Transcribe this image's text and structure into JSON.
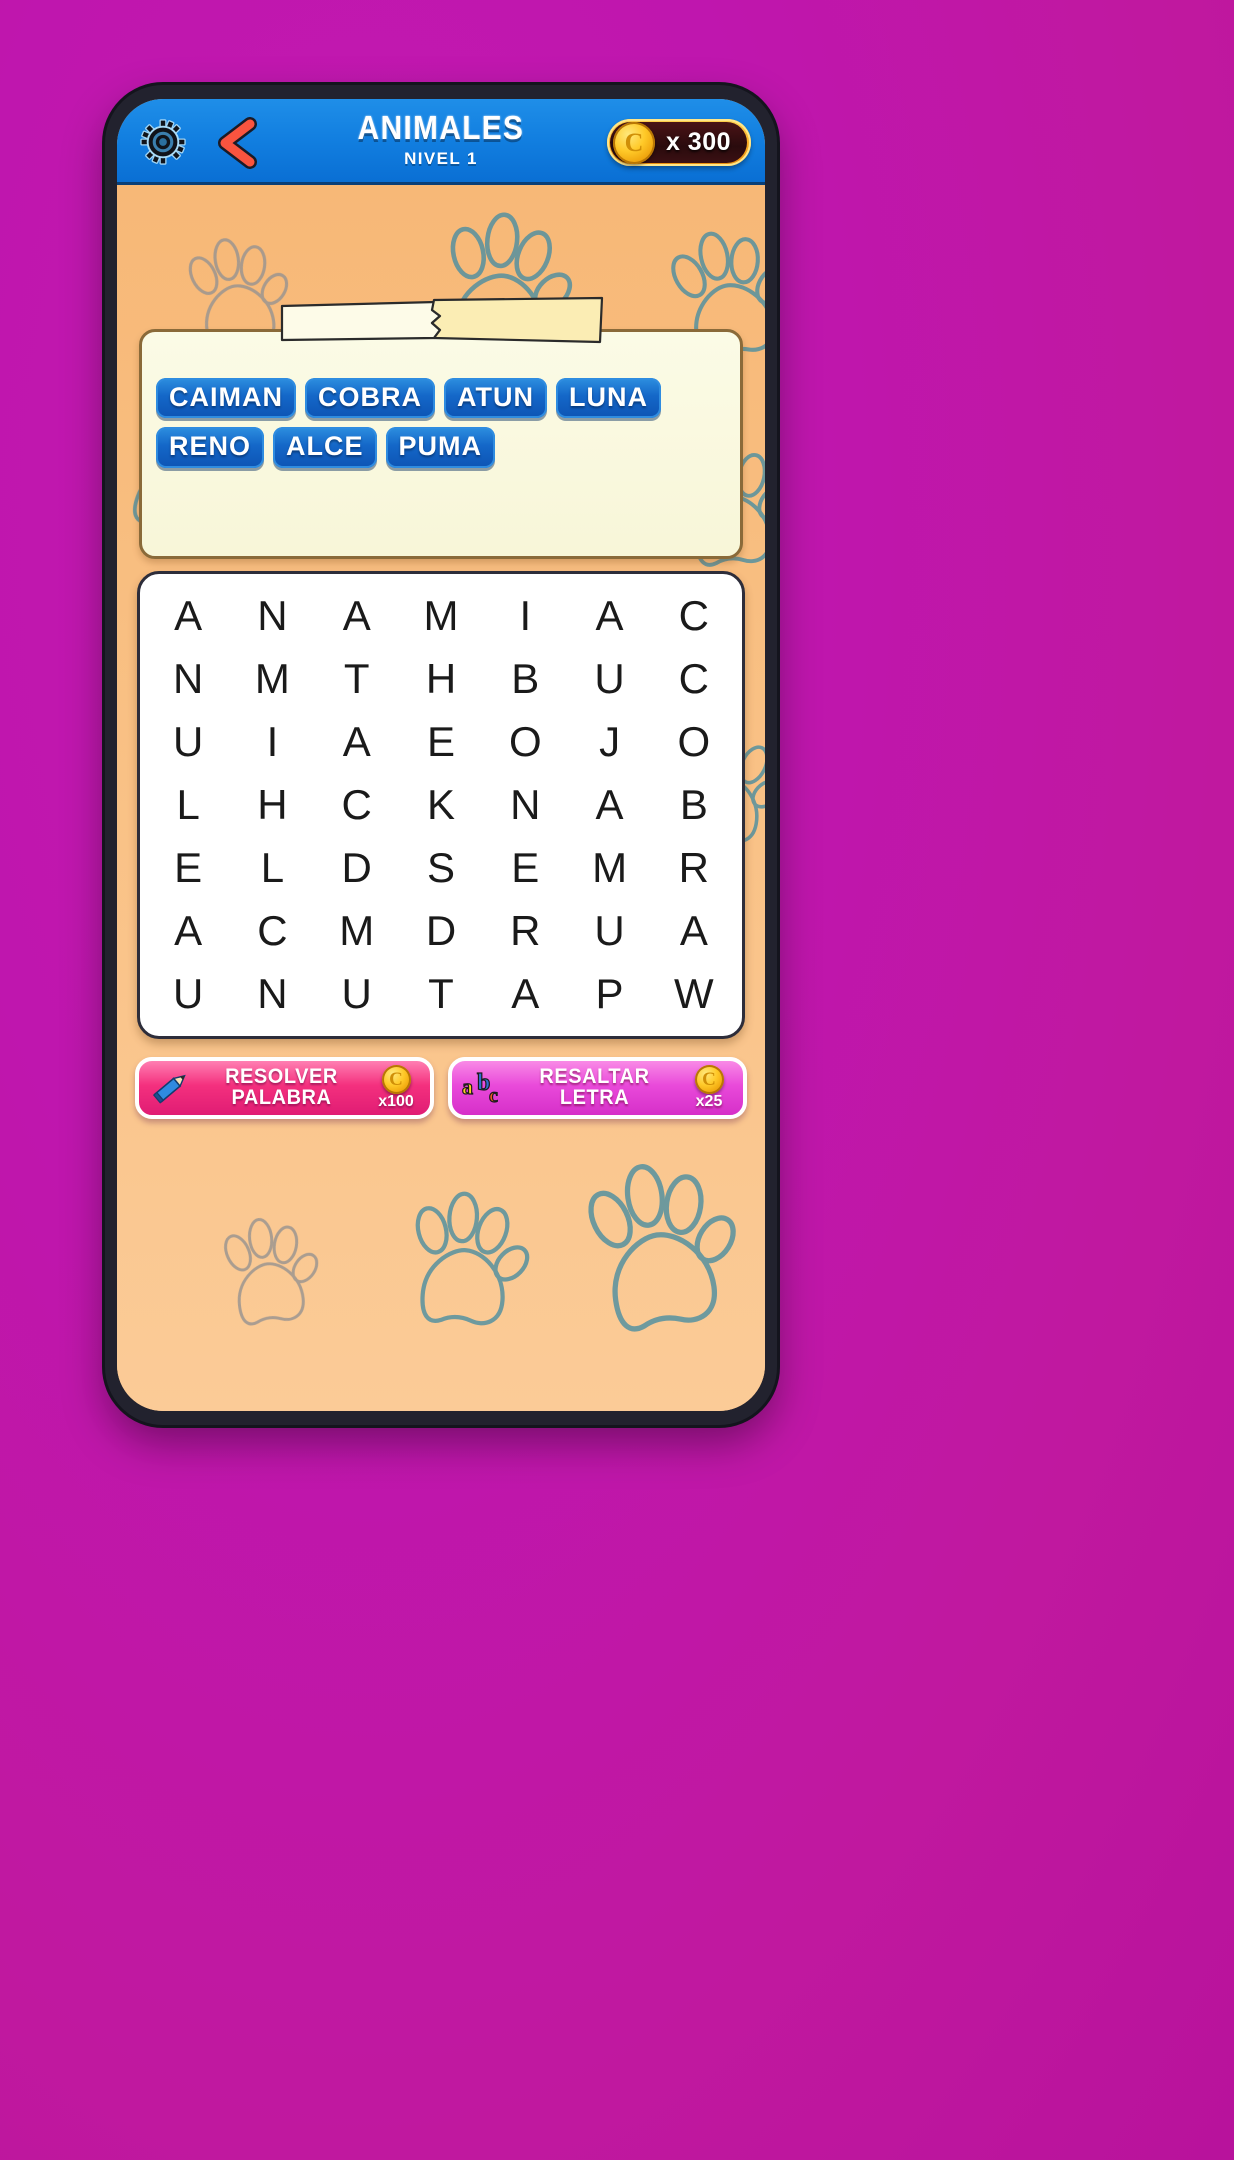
{
  "header": {
    "title": "ANIMALES",
    "subtitle": "NIVEL 1",
    "settings_icon": "gear-icon",
    "back_icon": "back-arrow-icon",
    "coin_icon": "coin-icon",
    "coin_amount": "x 300"
  },
  "words_panel": {
    "banner_label": "",
    "words": [
      {
        "text": "CAIMAN",
        "found": false
      },
      {
        "text": "COBRA",
        "found": false
      },
      {
        "text": "ATUN",
        "found": false
      },
      {
        "text": "LUNA",
        "found": false
      },
      {
        "text": "RENO",
        "found": false
      },
      {
        "text": "ALCE",
        "found": false
      },
      {
        "text": "PUMA",
        "found": false
      }
    ]
  },
  "grid": {
    "rows": 7,
    "cols": 7,
    "letters": [
      [
        "A",
        "N",
        "A",
        "M",
        "I",
        "A",
        "C"
      ],
      [
        "N",
        "M",
        "T",
        "H",
        "B",
        "U",
        "C"
      ],
      [
        "U",
        "I",
        "A",
        "E",
        "O",
        "J",
        "O"
      ],
      [
        "L",
        "H",
        "C",
        "K",
        "N",
        "A",
        "B"
      ],
      [
        "E",
        "L",
        "D",
        "S",
        "E",
        "M",
        "R"
      ],
      [
        "A",
        "C",
        "M",
        "D",
        "R",
        "U",
        "A"
      ],
      [
        "U",
        "N",
        "U",
        "T",
        "A",
        "P",
        "W"
      ]
    ]
  },
  "actions": {
    "solve": {
      "line1": "RESOLVER",
      "line2": "PALABRA",
      "icon": "pencil-icon",
      "cost": "x100",
      "coin_icon": "coin-icon"
    },
    "hint": {
      "line1": "RESALTAR",
      "line2": "LETRA",
      "icon": "abc-icon",
      "cost": "x25",
      "coin_icon": "coin-icon"
    }
  },
  "colors": {
    "page_background": "#c118a8",
    "header_blue": "#1280e1",
    "play_background": "#f8bd7e",
    "chip_blue": "#1467c8",
    "panel_cream": "#fbfbe6",
    "solve_pink": "#f4307e",
    "hint_magenta": "#e94ada",
    "coin_gold": "#ffc928",
    "grid_white": "#ffffff"
  }
}
